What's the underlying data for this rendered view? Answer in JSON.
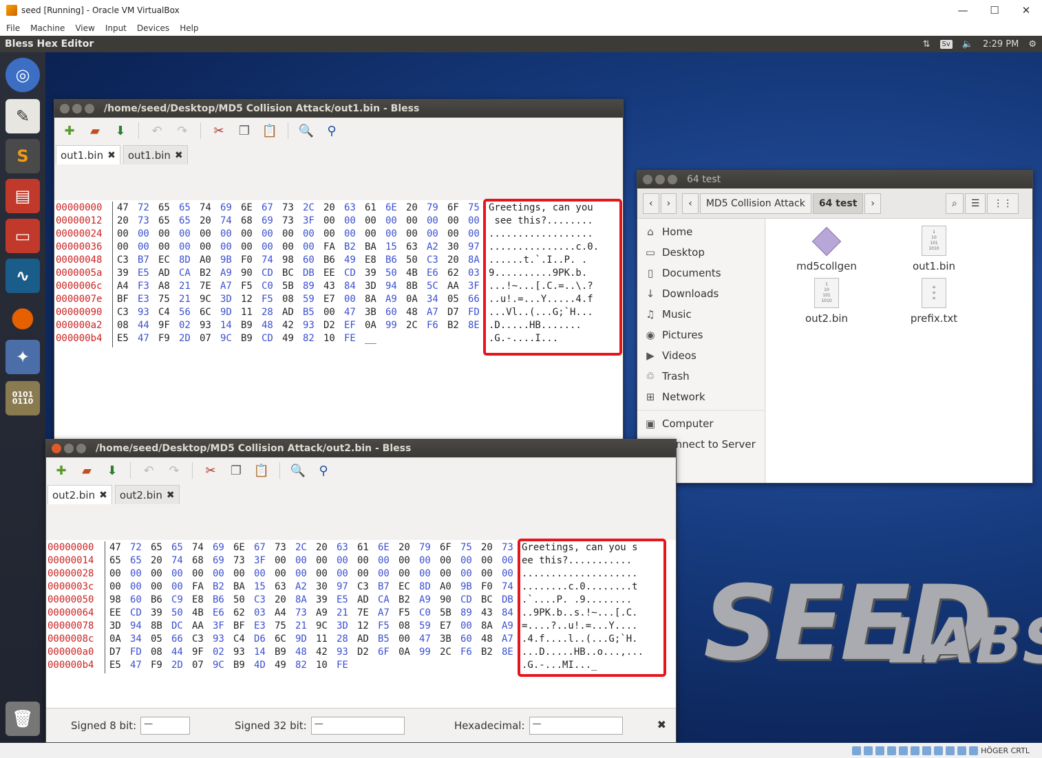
{
  "host": {
    "title": "seed [Running] - Oracle VM VirtualBox",
    "menu": [
      "File",
      "Machine",
      "View",
      "Input",
      "Devices",
      "Help"
    ],
    "host_key": "HÖGER CRTL"
  },
  "guest": {
    "app_name": "Bless Hex Editor",
    "keyboard": "Sv",
    "clock": "2:29 PM"
  },
  "bless1": {
    "title": "/home/seed/Desktop/MD5 Collision Attack/out1.bin - Bless",
    "tabs": [
      "out1.bin",
      "out1.bin"
    ],
    "offsets": [
      "00000000",
      "00000012",
      "00000024",
      "00000036",
      "00000048",
      "0000005a",
      "0000006c",
      "0000007e",
      "00000090",
      "000000a2",
      "000000b4"
    ],
    "ascii": [
      "Greetings, can you",
      " see this?........",
      "..................",
      "...............c.0.",
      "......t.`.I..P. .",
      "9..........9PK.b.",
      "...!~...[.C.=..\\.?",
      "..u!.=...Y.....4.f",
      "...Vl..(...G;`H...",
      ".D.....HB.......",
      ".G.-....I..."
    ]
  },
  "bless2": {
    "title": "/home/seed/Desktop/MD5 Collision Attack/out2.bin - Bless",
    "tabs": [
      "out2.bin",
      "out2.bin"
    ],
    "offsets": [
      "00000000",
      "00000014",
      "00000028",
      "0000003c",
      "00000050",
      "00000064",
      "00000078",
      "0000008c",
      "000000a0",
      "000000b4"
    ],
    "ascii": [
      "Greetings, can you s",
      "ee this?...........",
      "....................",
      "........c.0........t",
      ".`....P. .9........",
      "..9PK.b..s.!~...[.C.",
      "=....?..u!.=...Y....",
      ".4.f....l..(...G;`H.",
      "...D.....HB..o...,...",
      ".G.-...MI..._"
    ],
    "status": {
      "signed8_label": "Signed 8 bit:",
      "signed8_value": "—",
      "signed32_label": "Signed 32 bit:",
      "signed32_value": "—",
      "hex_label": "Hexadecimal:",
      "hex_value": "—"
    }
  },
  "files": {
    "title": "64 test",
    "path": [
      "MD5 Collision Attack",
      "64 test"
    ],
    "sidebar": [
      "Home",
      "Desktop",
      "Documents",
      "Downloads",
      "Music",
      "Pictures",
      "Videos",
      "Trash",
      "Network",
      "Computer",
      "Connect to Server"
    ],
    "items": [
      "md5collgen",
      "out1.bin",
      "out2.bin",
      "prefix.txt"
    ]
  }
}
